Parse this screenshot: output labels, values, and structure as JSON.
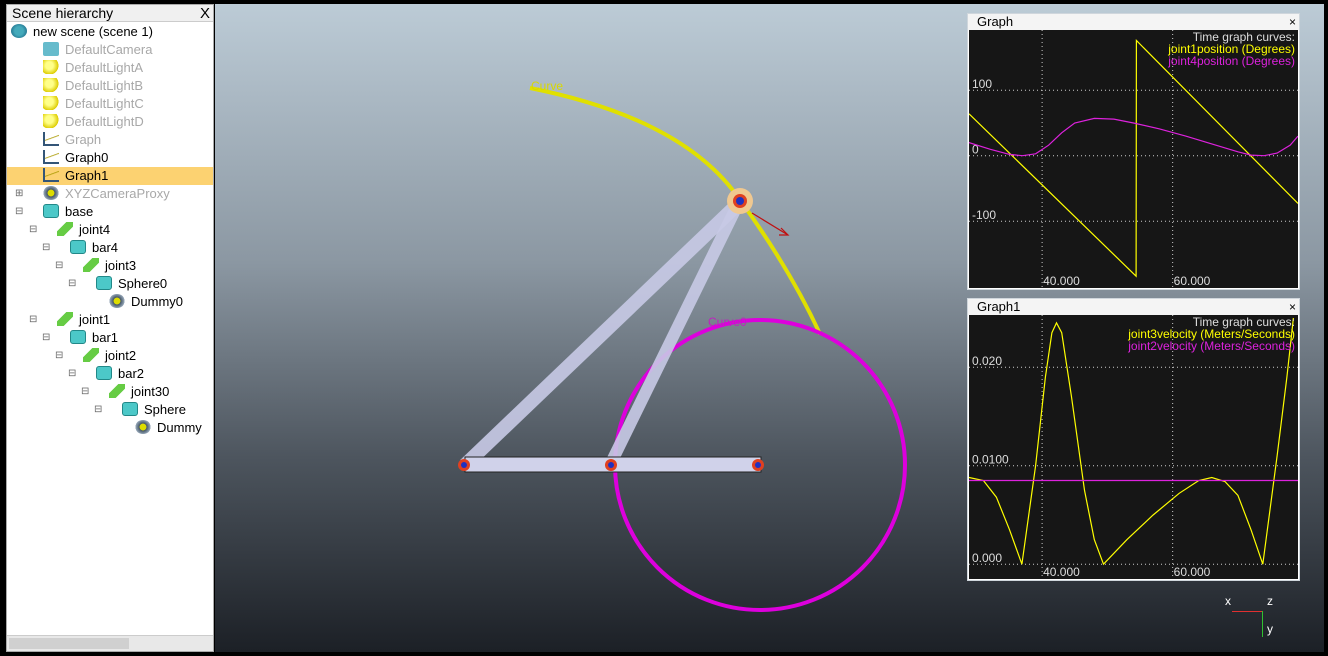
{
  "hierarchy": {
    "title": "Scene hierarchy",
    "close": "X",
    "items": [
      {
        "label": "new scene (scene 1)",
        "level": 0,
        "icon": "globe-icon",
        "dim": false
      },
      {
        "label": "DefaultCamera",
        "level": 1,
        "icon": "camera-icon",
        "dim": true
      },
      {
        "label": "DefaultLightA",
        "level": 1,
        "icon": "light-icon",
        "dim": true
      },
      {
        "label": "DefaultLightB",
        "level": 1,
        "icon": "light-icon",
        "dim": true
      },
      {
        "label": "DefaultLightC",
        "level": 1,
        "icon": "light-icon",
        "dim": true
      },
      {
        "label": "DefaultLightD",
        "level": 1,
        "icon": "light-icon",
        "dim": true
      },
      {
        "label": "Graph",
        "level": 1,
        "icon": "graph-icon",
        "dim": true
      },
      {
        "label": "Graph0",
        "level": 1,
        "icon": "graph-icon",
        "dim": false
      },
      {
        "label": "Graph1",
        "level": 1,
        "icon": "graph-icon",
        "dim": false,
        "selected": true
      },
      {
        "label": "XYZCameraProxy",
        "level": 1,
        "icon": "dummy-icon",
        "dim": true,
        "exp": "+"
      },
      {
        "label": "base",
        "level": 1,
        "icon": "shape-icon",
        "dim": false,
        "exp": "-"
      },
      {
        "label": "joint4",
        "level": 2,
        "icon": "joint-icon",
        "dim": false,
        "exp": "-"
      },
      {
        "label": "bar4",
        "level": 3,
        "icon": "shape-icon",
        "dim": false,
        "exp": "-"
      },
      {
        "label": "joint3",
        "level": 4,
        "icon": "joint-icon",
        "dim": false,
        "exp": "-"
      },
      {
        "label": "Sphere0",
        "level": 5,
        "icon": "shape-icon",
        "dim": false,
        "exp": "-"
      },
      {
        "label": "Dummy0",
        "level": 6,
        "icon": "dummy-icon",
        "dim": false
      },
      {
        "label": "joint1",
        "level": 2,
        "icon": "joint-icon",
        "dim": false,
        "exp": "-"
      },
      {
        "label": "bar1",
        "level": 3,
        "icon": "shape-icon",
        "dim": false,
        "exp": "-"
      },
      {
        "label": "joint2",
        "level": 4,
        "icon": "joint-icon",
        "dim": false,
        "exp": "-"
      },
      {
        "label": "bar2",
        "level": 5,
        "icon": "shape-icon",
        "dim": false,
        "exp": "-"
      },
      {
        "label": "joint30",
        "level": 6,
        "icon": "joint-icon",
        "dim": false,
        "exp": "-"
      },
      {
        "label": "Sphere",
        "level": 7,
        "icon": "shape-icon",
        "dim": false,
        "exp": "-"
      },
      {
        "label": "Dummy",
        "level": 8,
        "icon": "dummy-icon",
        "dim": false
      }
    ]
  },
  "scene": {
    "curve_label": "Curve",
    "curve0_label": "Curve0",
    "curve_color": "#e0e000",
    "curve0_color": "#dd00dd",
    "bar_color": "#c8cae6",
    "axes": {
      "x": "x",
      "y": "y",
      "z": "z"
    }
  },
  "chart_data": [
    {
      "type": "line",
      "title": "Graph",
      "legend_title": "Time graph curves:",
      "legend_placement": "top-right",
      "grid": true,
      "xlim": [
        28.8,
        79.2
      ],
      "ylim": [
        -202,
        192
      ],
      "xticks": [
        40,
        60
      ],
      "xtick_labels": [
        "40.000",
        "60.000"
      ],
      "yticks": [
        100,
        0,
        -100
      ],
      "ytick_labels": [
        "100",
        "0",
        "-100"
      ],
      "series": [
        {
          "name": "joint1position (Degrees)",
          "color": "#ffff00",
          "points": [
            [
              28.8,
              64
            ],
            [
              54.4,
              -184
            ],
            [
              54.45,
              176
            ],
            [
              79.2,
              -73
            ]
          ]
        },
        {
          "name": "joint4position (Degrees)",
          "color": "#dd22dd",
          "points": [
            [
              28.8,
              20
            ],
            [
              32,
              10
            ],
            [
              35,
              2
            ],
            [
              37,
              0
            ],
            [
              39,
              3
            ],
            [
              41,
              16
            ],
            [
              43,
              35
            ],
            [
              45,
              50
            ],
            [
              48,
              57
            ],
            [
              51,
              56
            ],
            [
              54,
              50
            ],
            [
              58,
              41
            ],
            [
              62,
              30
            ],
            [
              66,
              18
            ],
            [
              70,
              6
            ],
            [
              72,
              1
            ],
            [
              74,
              0
            ],
            [
              76,
              4
            ],
            [
              78,
              16
            ],
            [
              79.2,
              30
            ]
          ]
        }
      ]
    },
    {
      "type": "line",
      "title": "Graph1",
      "legend_title": "Time graph curves:",
      "legend_placement": "top-right",
      "grid": true,
      "xlim": [
        28.8,
        79.2
      ],
      "ylim": [
        -0.0015,
        0.0253
      ],
      "xticks": [
        40,
        60
      ],
      "xtick_labels": [
        "40.000",
        "60.000"
      ],
      "yticks": [
        0.02,
        0.01,
        0
      ],
      "ytick_labels": [
        "0.020",
        "0.0100",
        "0.000"
      ],
      "series": [
        {
          "name": "joint3velocity (Meters/Seconds)",
          "color": "#ffff00",
          "points": [
            [
              28.8,
              0.0088
            ],
            [
              31,
              0.0085
            ],
            [
              33,
              0.0068
            ],
            [
              35,
              0.0035
            ],
            [
              36.9,
              0
            ],
            [
              39,
              0.01
            ],
            [
              40.5,
              0.019
            ],
            [
              41.5,
              0.0235
            ],
            [
              42.2,
              0.0245
            ],
            [
              43,
              0.0235
            ],
            [
              44.5,
              0.017
            ],
            [
              46.5,
              0.0075
            ],
            [
              48,
              0.0025
            ],
            [
              49.4,
              0
            ],
            [
              53,
              0.0025
            ],
            [
              57,
              0.005
            ],
            [
              61,
              0.0072
            ],
            [
              64,
              0.0085
            ],
            [
              66,
              0.0088
            ],
            [
              68,
              0.0084
            ],
            [
              70,
              0.007
            ],
            [
              72,
              0.0035
            ],
            [
              73.8,
              0
            ],
            [
              76,
              0.011
            ],
            [
              77.5,
              0.019
            ],
            [
              78.5,
              0.025
            ]
          ]
        },
        {
          "name": "joint2velocity (Meters/Seconds)",
          "color": "#dd22dd",
          "points": [
            [
              28.8,
              0.0085
            ],
            [
              79.2,
              0.0085
            ]
          ]
        }
      ]
    }
  ]
}
